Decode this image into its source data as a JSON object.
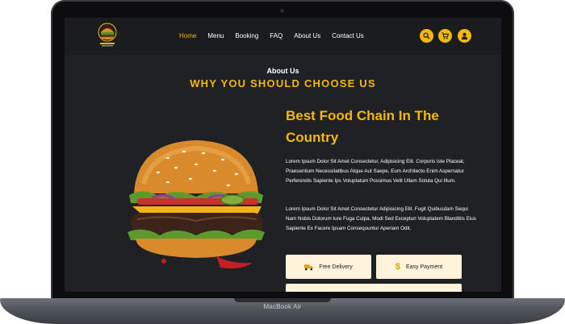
{
  "device": {
    "model_name": "MacBook Air"
  },
  "nav": {
    "items": [
      {
        "label": "Home",
        "active": true
      },
      {
        "label": "Menu",
        "active": false
      },
      {
        "label": "Booking",
        "active": false
      },
      {
        "label": "FAQ",
        "active": false
      },
      {
        "label": "About Us",
        "active": false
      },
      {
        "label": "Contact Us",
        "active": false
      }
    ],
    "icons": [
      "search-icon",
      "cart-icon",
      "user-icon"
    ]
  },
  "about": {
    "eyebrow": "About Us",
    "title": "WHY YOU SHOULD CHOOSE US",
    "headline": "Best Food Chain In The Country",
    "paragraph_1": "Lorem Ipsum Dolor Sit Amet Consectetur, Adipisicing Elit. Corporis Iste Placeat, Praesentium Necessitatibus Atque Aut Saepe, Eum Architecto Enim Aspernatur Perferendis Sapiente Ips Voluptatum Possimus Velit Ullam Soluta Qui Illum.",
    "paragraph_2": "Lorem Ipsum Dolor Sit Amet Consectetur Adipisicing Elit. Fugit Quibusdam Sequi Nam Nobis Dolorum Iure Fuga Culpa, Modi Sed Excepturi Voluptatem Blanditiis Eius Sapiente Ex Facere Ipsam Consequuntur Aperiam Odit.",
    "features": [
      {
        "label": "Free Delivery",
        "icon": "truck-icon"
      },
      {
        "label": "Easy Payment",
        "icon": "dollar-icon"
      }
    ]
  },
  "colors": {
    "accent": "#f6b809",
    "background": "#1f2125",
    "card": "#fff3dc"
  }
}
